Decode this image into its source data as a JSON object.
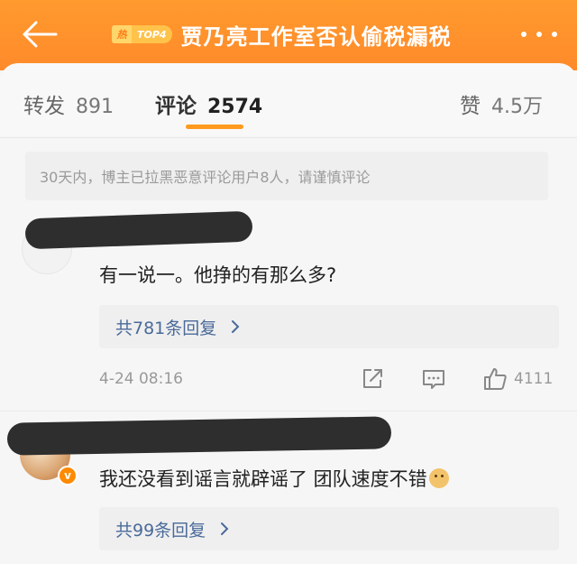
{
  "header": {
    "badge_mark": "热",
    "badge_text": "TOP4",
    "title": "贾乃亮工作室否认偷税漏税"
  },
  "tabs": [
    {
      "label": "转发",
      "count": "891"
    },
    {
      "label": "评论",
      "count": "2574"
    },
    {
      "label": "赞",
      "count": "4.5万"
    }
  ],
  "notice": "30天内，博主已拉黑恶意评论用户8人，请谨慎评论",
  "comments": [
    {
      "text": "有一说一。他挣的有那么多?",
      "replies": "共781条回复",
      "time": "4-24  08:16",
      "likes": "4111"
    },
    {
      "text": "我还没看到谣言就辟谣了  团队速度不错",
      "replies": "共99条回复",
      "verified_mark": "v"
    }
  ],
  "colors": {
    "header_orange": "#ff9a2e",
    "tab_underline": "#ff9a1e",
    "reply_link": "#4a6a9a"
  }
}
